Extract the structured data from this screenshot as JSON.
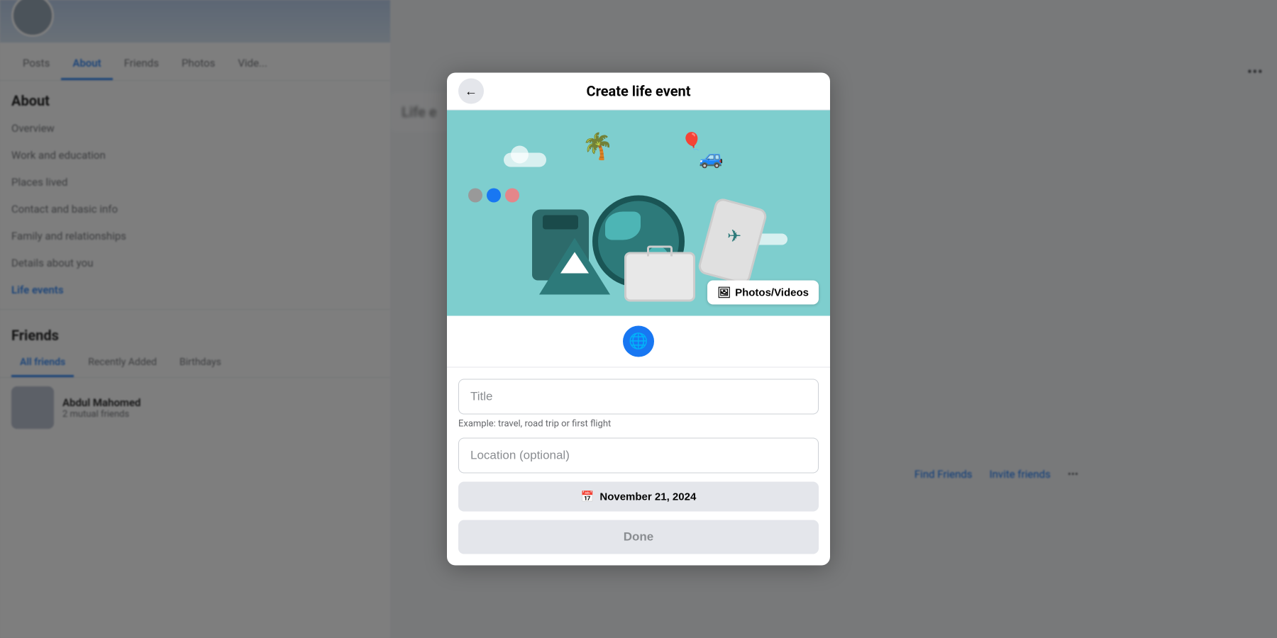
{
  "page": {
    "title": "Facebook"
  },
  "nav_tabs": {
    "posts": "Posts",
    "about": "About",
    "friends": "Friends",
    "photos": "Photos",
    "videos": "Vide..."
  },
  "about_section": {
    "heading": "About",
    "overview": "Overview",
    "work_education": "Work and education",
    "places_lived": "Places lived",
    "contact_basic_info": "Contact and basic info",
    "family_relationships": "Family and relationships",
    "details_about_you": "Details about you",
    "life_events": "Life events"
  },
  "friends_section": {
    "heading": "Friends",
    "tabs": {
      "all_friends": "All friends",
      "recently_added": "Recently Added",
      "birthdays": "Birthdays"
    },
    "friend_item": {
      "name": "Abdul Mahomed",
      "mutual": "2 mutual friends"
    },
    "nav_items": {
      "find_friends": "Find Friends",
      "invite_friends": "Invite friends"
    }
  },
  "life_events_content": {
    "heading": "Life e"
  },
  "modal": {
    "title": "Create life event",
    "back_btn": "←",
    "title_placeholder": "Title",
    "example_hint": "Example: travel, road trip or first flight",
    "location_placeholder": "Location (optional)",
    "date_btn": "November 21, 2024",
    "done_btn": "Done",
    "photos_videos_btn": "Photos/Videos",
    "globe_icon": "🌐"
  },
  "illustration": {
    "palm": "🌴",
    "car": "🚙",
    "balloon": "🎈",
    "dot1_color": "#999",
    "dot2_color": "#1877f2",
    "dot3_color": "#e4868a"
  }
}
